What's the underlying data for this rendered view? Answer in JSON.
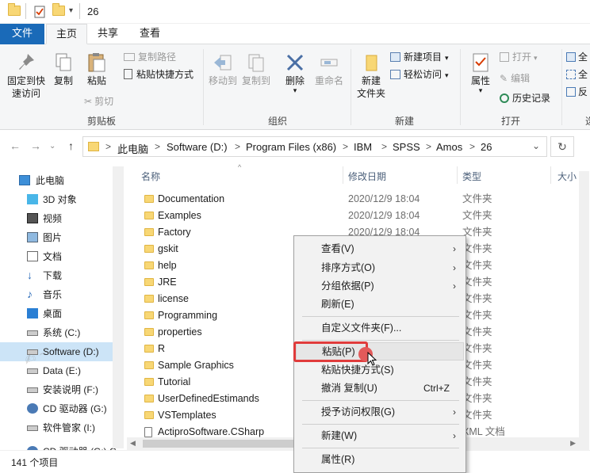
{
  "window": {
    "title": "26"
  },
  "ribbon_tabs": {
    "file": "文件",
    "home": "主页",
    "share": "共享",
    "view": "查看"
  },
  "ribbon": {
    "pin_line1": "固定到快",
    "pin_line2": "速访问",
    "copy": "复制",
    "paste": "粘贴",
    "copy_path": "复制路径",
    "paste_shortcut": "粘贴快捷方式",
    "cut": "剪切",
    "clipboard_group": "剪贴板",
    "move_to": "移动到",
    "copy_to": "复制到",
    "delete": "删除",
    "rename": "重命名",
    "organize_group": "组织",
    "new_folder_line1": "新建",
    "new_folder_line2": "文件夹",
    "new_item": "新建项目",
    "easy_access": "轻松访问",
    "new_group": "新建",
    "properties": "属性",
    "open": "打开",
    "edit": "编辑",
    "history": "历史记录",
    "open_group": "打开",
    "all_partial": "全",
    "all_partial2": "全",
    "invert_partial": "反",
    "select_partial": "选"
  },
  "address": {
    "crumbs": [
      "此电脑",
      "Software (D:)",
      "Program Files (x86)",
      "IBM",
      "SPSS",
      "Amos",
      "26"
    ],
    "separator": ">"
  },
  "nav_pane": {
    "items": [
      {
        "label": "此电脑",
        "icon": "pc-icon"
      },
      {
        "label": "3D 对象",
        "icon": "3d-objects-icon"
      },
      {
        "label": "视频",
        "icon": "video-icon"
      },
      {
        "label": "图片",
        "icon": "pictures-icon"
      },
      {
        "label": "文档",
        "icon": "documents-icon"
      },
      {
        "label": "下载",
        "icon": "download-icon"
      },
      {
        "label": "音乐",
        "icon": "music-icon"
      },
      {
        "label": "桌面",
        "icon": "desktop-icon"
      },
      {
        "label": "系统 (C:)",
        "icon": "drive-icon"
      },
      {
        "label": "Software (D:)",
        "icon": "drive-icon"
      },
      {
        "label": "Data (E:)",
        "icon": "drive-icon"
      },
      {
        "label": "安装说明 (F:)",
        "icon": "drive-icon"
      },
      {
        "label": "CD 驱动器 (G:)",
        "icon": "cd-drive-icon"
      },
      {
        "label": "软件管家 (I:)",
        "icon": "drive-icon"
      },
      {
        "label": "CD 驱动器 (G:) C",
        "icon": "cd-drive-icon"
      }
    ]
  },
  "file_list": {
    "columns": {
      "name": "名称",
      "date": "修改日期",
      "type": "类型",
      "size": "大小"
    },
    "rows": [
      {
        "name": "Documentation",
        "date": "2020/12/9 18:04",
        "type": "文件夹"
      },
      {
        "name": "Examples",
        "date": "2020/12/9 18:04",
        "type": "文件夹"
      },
      {
        "name": "Factory",
        "date": "2020/12/9 18:04",
        "type": "文件夹"
      },
      {
        "name": "gskit",
        "date": "",
        "type": "文件夹"
      },
      {
        "name": "help",
        "date": "",
        "type": "文件夹"
      },
      {
        "name": "JRE",
        "date": "",
        "type": "文件夹"
      },
      {
        "name": "license",
        "date": "",
        "type": "文件夹"
      },
      {
        "name": "Programming",
        "date": "",
        "type": "文件夹"
      },
      {
        "name": "properties",
        "date": "",
        "type": "文件夹"
      },
      {
        "name": "R",
        "date": "",
        "type": "文件夹"
      },
      {
        "name": "Sample Graphics",
        "date": "",
        "type": "文件夹"
      },
      {
        "name": "Tutorial",
        "date": "",
        "type": "文件夹"
      },
      {
        "name": "UserDefinedEstimands",
        "date": "",
        "type": "文件夹"
      },
      {
        "name": "VSTemplates",
        "date": "",
        "type": "文件夹"
      },
      {
        "name": "ActiproSoftware.CSharp",
        "date": "",
        "type": "XML 文档"
      }
    ]
  },
  "context_menu": {
    "view": "查看(V)",
    "sort": "排序方式(O)",
    "group": "分组依据(P)",
    "refresh": "刷新(E)",
    "customize": "自定义文件夹(F)...",
    "paste": "粘贴(P)",
    "paste_shortcut": "粘贴快捷方式(S)",
    "undo": "撤消 复制(U)",
    "undo_shortcut": "Ctrl+Z",
    "grant_access": "授予访问权限(G)",
    "new": "新建(W)",
    "properties": "属性(R)",
    "arrow": "›"
  },
  "status": {
    "count": "141 个项目"
  },
  "colors": {
    "accent": "#1a6ab8",
    "selection": "#cce4f7",
    "highlight_box": "#e03b3b"
  }
}
